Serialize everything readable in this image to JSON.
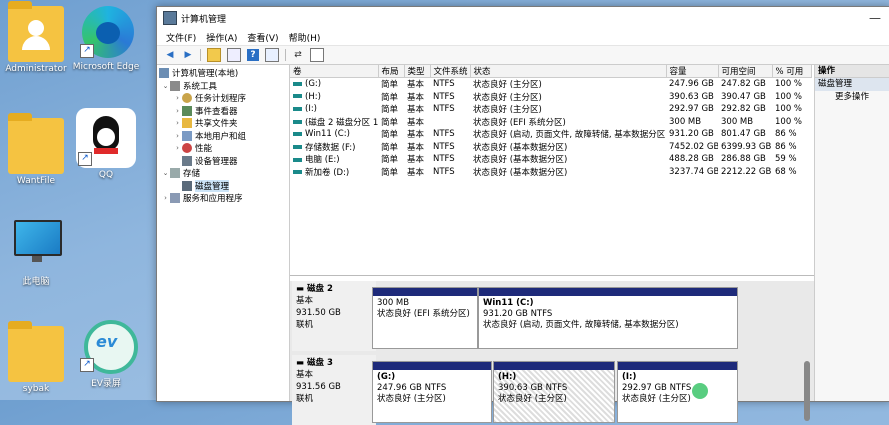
{
  "desktop": {
    "icons": [
      {
        "label": "Administrator"
      },
      {
        "label": "Microsoft Edge"
      },
      {
        "label": "WantFile"
      },
      {
        "label": "QQ"
      },
      {
        "label": "此电脑"
      },
      {
        "label": "sybak"
      },
      {
        "label": "EV录屏"
      }
    ]
  },
  "window": {
    "title": "计算机管理",
    "menu": [
      "文件(F)",
      "操作(A)",
      "查看(V)",
      "帮助(H)"
    ]
  },
  "tree": {
    "items": [
      {
        "label": "计算机管理(本地)",
        "exp": "",
        "level": 0
      },
      {
        "label": "系统工具",
        "exp": "⌄",
        "level": 1
      },
      {
        "label": "任务计划程序",
        "exp": "›",
        "level": 2
      },
      {
        "label": "事件查看器",
        "exp": "›",
        "level": 2
      },
      {
        "label": "共享文件夹",
        "exp": "›",
        "level": 2
      },
      {
        "label": "本地用户和组",
        "exp": "›",
        "level": 2
      },
      {
        "label": "性能",
        "exp": "›",
        "level": 2
      },
      {
        "label": "设备管理器",
        "exp": "",
        "level": 2
      },
      {
        "label": "存储",
        "exp": "⌄",
        "level": 1
      },
      {
        "label": "磁盘管理",
        "exp": "",
        "level": 2,
        "selected": true
      },
      {
        "label": "服务和应用程序",
        "exp": "›",
        "level": 1
      }
    ]
  },
  "volumes": {
    "headers": [
      "卷",
      "布局",
      "类型",
      "文件系统",
      "状态",
      "容量",
      "可用空间",
      "% 可用"
    ],
    "rows": [
      [
        "(G:)",
        "简单",
        "基本",
        "NTFS",
        "状态良好 (主分区)",
        "247.96 GB",
        "247.82 GB",
        "100 %"
      ],
      [
        "(H:)",
        "简单",
        "基本",
        "NTFS",
        "状态良好 (主分区)",
        "390.63 GB",
        "390.47 GB",
        "100 %"
      ],
      [
        "(I:)",
        "简单",
        "基本",
        "NTFS",
        "状态良好 (主分区)",
        "292.97 GB",
        "292.82 GB",
        "100 %"
      ],
      [
        "(磁盘 2 磁盘分区 1)",
        "简单",
        "基本",
        "",
        "状态良好 (EFI 系统分区)",
        "300 MB",
        "300 MB",
        "100 %"
      ],
      [
        "Win11 (C:)",
        "简单",
        "基本",
        "NTFS",
        "状态良好 (启动, 页面文件, 故障转储, 基本数据分区)",
        "931.20 GB",
        "801.47 GB",
        "86 %"
      ],
      [
        "存储数据 (F:)",
        "简单",
        "基本",
        "NTFS",
        "状态良好 (基本数据分区)",
        "7452.02 GB",
        "6399.93 GB",
        "86 %"
      ],
      [
        "电脑 (E:)",
        "简单",
        "基本",
        "NTFS",
        "状态良好 (基本数据分区)",
        "488.28 GB",
        "286.88 GB",
        "59 %"
      ],
      [
        "新加卷 (D:)",
        "简单",
        "基本",
        "NTFS",
        "状态良好 (基本数据分区)",
        "3237.74 GB",
        "2212.22 GB",
        "68 %"
      ]
    ]
  },
  "disk2": {
    "name": "磁盘 2",
    "type": "基本",
    "size": "931.50 GB",
    "status": "联机",
    "parts": [
      {
        "name": "",
        "size": "300 MB",
        "status": "状态良好 (EFI 系统分区)"
      },
      {
        "name": "Win11 (C:)",
        "size": "931.20 GB NTFS",
        "status": "状态良好 (启动, 页面文件, 故障转储, 基本数据分区)"
      }
    ]
  },
  "disk3": {
    "name": "磁盘 3",
    "type": "基本",
    "size": "931.56 GB",
    "status": "联机",
    "parts": [
      {
        "name": "(G:)",
        "size": "247.96 GB NTFS",
        "status": "状态良好 (主分区)"
      },
      {
        "name": "(H:)",
        "size": "390.63 GB NTFS",
        "status": "状态良好 (主分区)"
      },
      {
        "name": "(I:)",
        "size": "292.97 GB NTFS",
        "status": "状态良好 (主分区)"
      }
    ]
  },
  "actions": {
    "header": "操作",
    "selected": "磁盘管理",
    "more": "更多操作"
  }
}
